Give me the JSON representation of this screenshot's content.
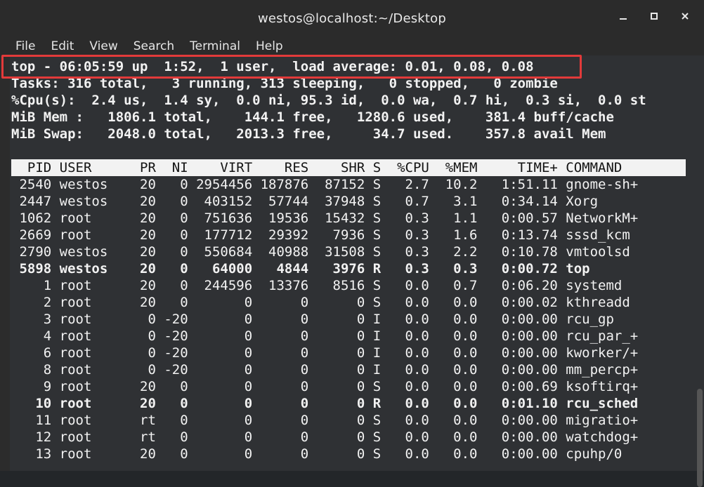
{
  "window": {
    "title": "westos@localhost:~/Desktop"
  },
  "menubar": [
    "File",
    "Edit",
    "View",
    "Search",
    "Terminal",
    "Help"
  ],
  "top_summary": {
    "line1": "top - 06:05:59 up  1:52,  1 user,  load average: 0.01, 0.08, 0.08",
    "line2": "Tasks: 316 total,   3 running, 313 sleeping,   0 stopped,   0 zombie",
    "line3": "%Cpu(s):  2.4 us,  1.4 sy,  0.0 ni, 95.3 id,  0.0 wa,  0.7 hi,  0.3 si,  0.0 st",
    "line4": "MiB Mem :   1806.1 total,    144.1 free,   1280.6 used,    381.4 buff/cache",
    "line5": "MiB Swap:   2048.0 total,   2013.3 free,     34.7 used.    357.8 avail Mem"
  },
  "table": {
    "header": "  PID USER      PR  NI    VIRT    RES    SHR S  %CPU  %MEM     TIME+ COMMAND",
    "rows": [
      {
        "text": " 2540 westos    20   0 2954456 187876  87152 S   2.7  10.2   1:51.11 gnome-sh+",
        "bold": false
      },
      {
        "text": " 2447 westos    20   0  403152  57744  37948 S   0.7   3.1   0:34.14 Xorg",
        "bold": false
      },
      {
        "text": " 1062 root      20   0  751636  19536  15432 S   0.3   1.1   0:00.57 NetworkM+",
        "bold": false
      },
      {
        "text": " 2669 root      20   0  177712  29392   7936 S   0.3   1.6   0:13.74 sssd_kcm",
        "bold": false
      },
      {
        "text": " 2790 westos    20   0  550684  40988  31508 S   0.3   2.2   0:10.78 vmtoolsd",
        "bold": false
      },
      {
        "text": " 5898 westos    20   0   64000   4844   3976 R   0.3   0.3   0:00.72 top",
        "bold": true
      },
      {
        "text": "    1 root      20   0  244596  13376   8516 S   0.0   0.7   0:06.20 systemd",
        "bold": false
      },
      {
        "text": "    2 root      20   0       0      0      0 S   0.0   0.0   0:00.02 kthreadd",
        "bold": false
      },
      {
        "text": "    3 root       0 -20       0      0      0 I   0.0   0.0   0:00.00 rcu_gp",
        "bold": false
      },
      {
        "text": "    4 root       0 -20       0      0      0 I   0.0   0.0   0:00.00 rcu_par_+",
        "bold": false
      },
      {
        "text": "    6 root       0 -20       0      0      0 I   0.0   0.0   0:00.00 kworker/+",
        "bold": false
      },
      {
        "text": "    8 root       0 -20       0      0      0 I   0.0   0.0   0:00.00 mm_percp+",
        "bold": false
      },
      {
        "text": "    9 root      20   0       0      0      0 S   0.0   0.0   0:00.69 ksoftirq+",
        "bold": false
      },
      {
        "text": "   10 root      20   0       0      0      0 R   0.0   0.0   0:01.10 rcu_sched",
        "bold": true
      },
      {
        "text": "   11 root      rt   0       0      0      0 S   0.0   0.0   0:00.00 migratio+",
        "bold": false
      },
      {
        "text": "   12 root      rt   0       0      0      0 S   0.0   0.0   0:00.00 watchdog+",
        "bold": false
      },
      {
        "text": "   13 root      20   0       0      0      0 S   0.0   0.0   0:00.00 cpuhp/0",
        "bold": false
      }
    ]
  },
  "icons": {
    "minimize": "minimize-icon",
    "maximize": "maximize-icon",
    "close": "close-icon"
  }
}
